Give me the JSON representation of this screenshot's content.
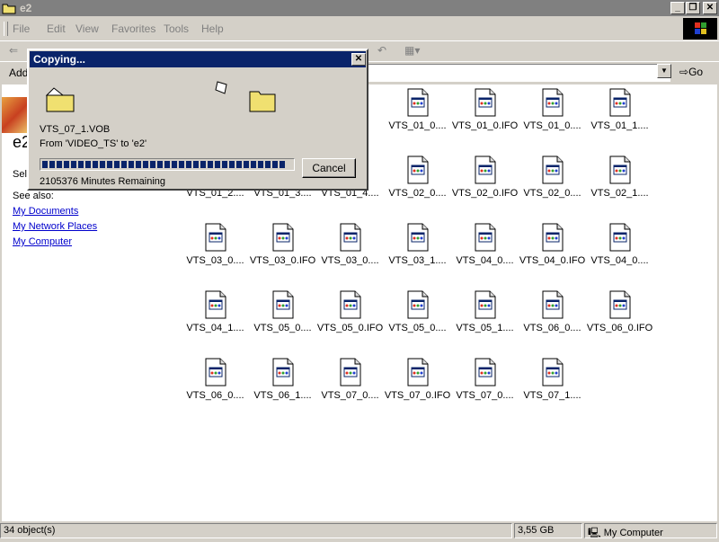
{
  "window": {
    "title": "e2",
    "min_glyph": "_",
    "max_glyph": "❐",
    "close_glyph": "✕"
  },
  "menu": [
    {
      "label": "File"
    },
    {
      "label": "Edit"
    },
    {
      "label": "View"
    },
    {
      "label": "Favorites"
    },
    {
      "label": "Tools"
    },
    {
      "label": "Help"
    }
  ],
  "address": {
    "label": "Add",
    "go": "Go",
    "drop_glyph": "▼"
  },
  "left_panel": {
    "title": "e2",
    "select_text": "Sel",
    "see_also": "See also:",
    "links": [
      "My Documents",
      "My Network Places",
      "My Computer"
    ]
  },
  "files": [
    "VTS_01_0....",
    "VTS_01_0.IFO",
    "VTS_01_0....",
    "VTS_01_1....",
    "VTS_01_2....",
    "VTS_01_3....",
    "VTS_01_4....",
    "VTS_02_0....",
    "VTS_02_0.IFO",
    "VTS_02_0....",
    "VTS_02_1....",
    "VTS_03_0....",
    "VTS_03_0.IFO",
    "VTS_03_0....",
    "VTS_03_1....",
    "VTS_04_0....",
    "VTS_04_0.IFO",
    "VTS_04_0....",
    "VTS_04_1....",
    "VTS_05_0....",
    "VTS_05_0.IFO",
    "VTS_05_0....",
    "VTS_05_1....",
    "VTS_06_0....",
    "VTS_06_0.IFO",
    "VTS_06_0....",
    "VTS_06_1....",
    "VTS_07_0....",
    "VTS_07_0.IFO",
    "VTS_07_0....",
    "VTS_07_1...."
  ],
  "status": {
    "objects": "34 object(s)",
    "size": "3,55 GB",
    "location": "My Computer"
  },
  "dialog": {
    "title": "Copying...",
    "close_glyph": "✕",
    "file": "VTS_07_1.VOB",
    "from_to": "From 'VIDEO_TS' to 'e2'",
    "remaining": "2105376 Minutes Remaining",
    "cancel": "Cancel",
    "progress_fraction": 0.98
  },
  "colors": {
    "dialog_titlebar": "#0a246a",
    "inactive_titlebar": "#808080",
    "progress": "#0a246a",
    "link": "#0000cc"
  }
}
